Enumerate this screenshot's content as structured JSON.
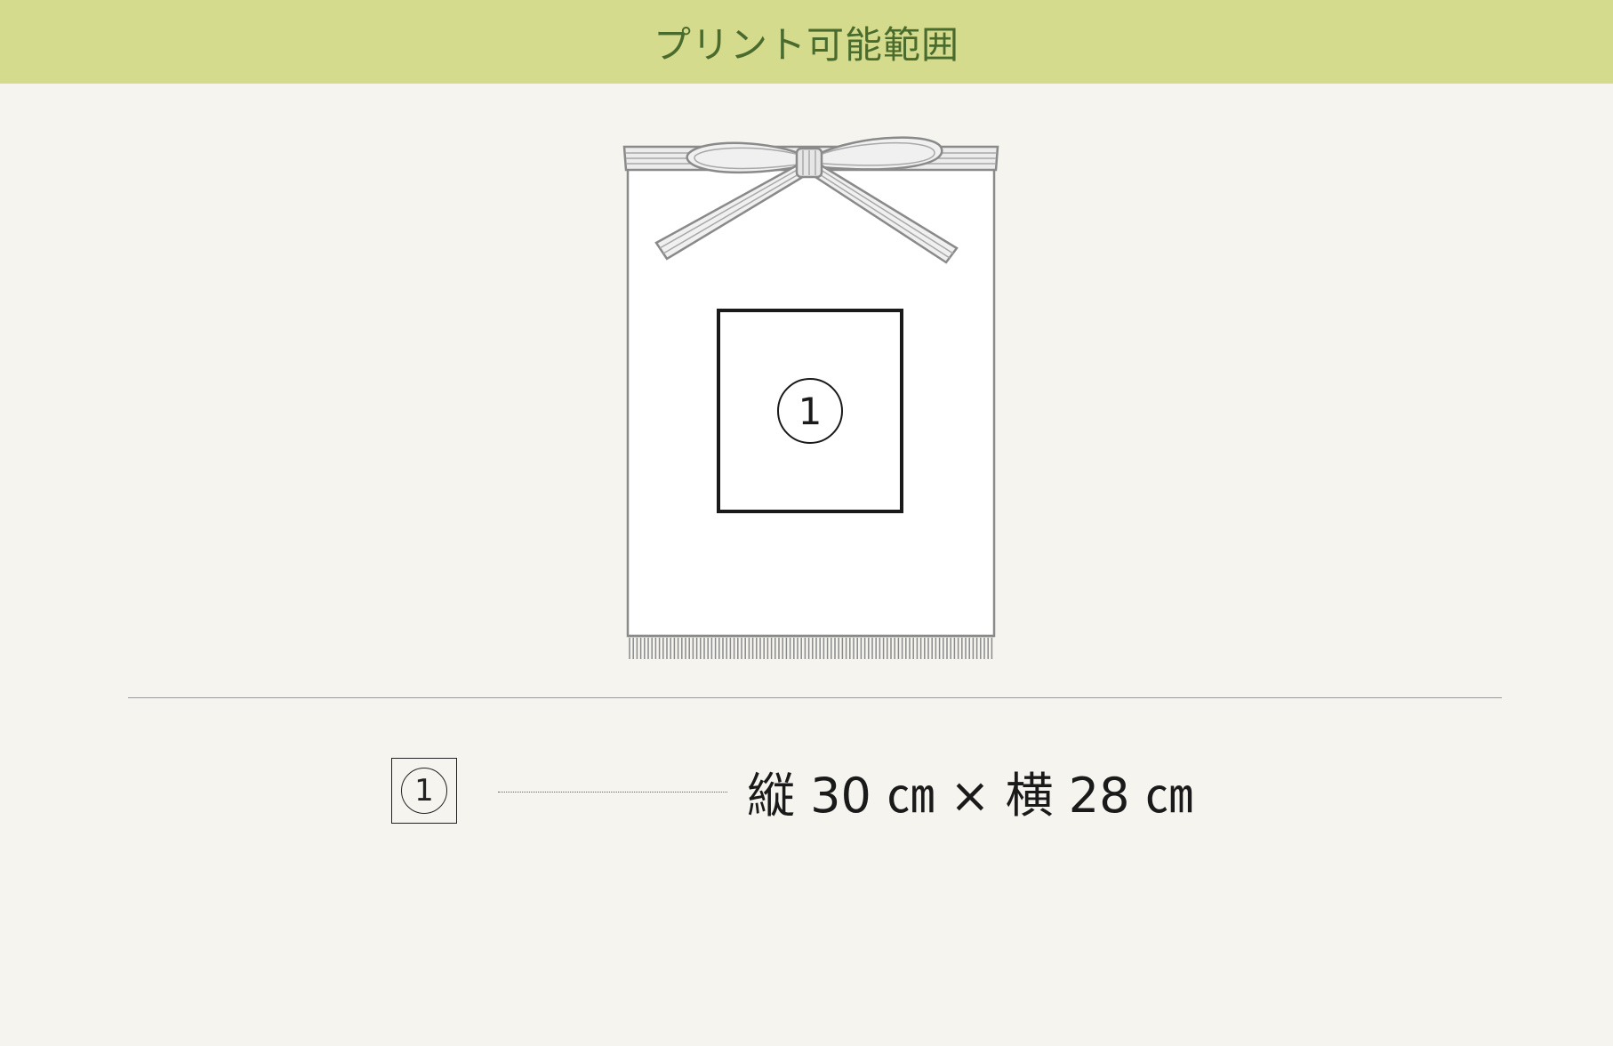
{
  "header": {
    "title": "プリント可能範囲"
  },
  "figure": {
    "area_marker": "1"
  },
  "spec": {
    "marker": "1",
    "size_text": "縦 30 ㎝ × 横 28 ㎝"
  },
  "colors": {
    "header_bg": "#d4db8c",
    "header_text": "#4a6b2e",
    "page_bg": "#f5f4ef",
    "outline": "#888888",
    "print_area": "#1a1a1a"
  }
}
